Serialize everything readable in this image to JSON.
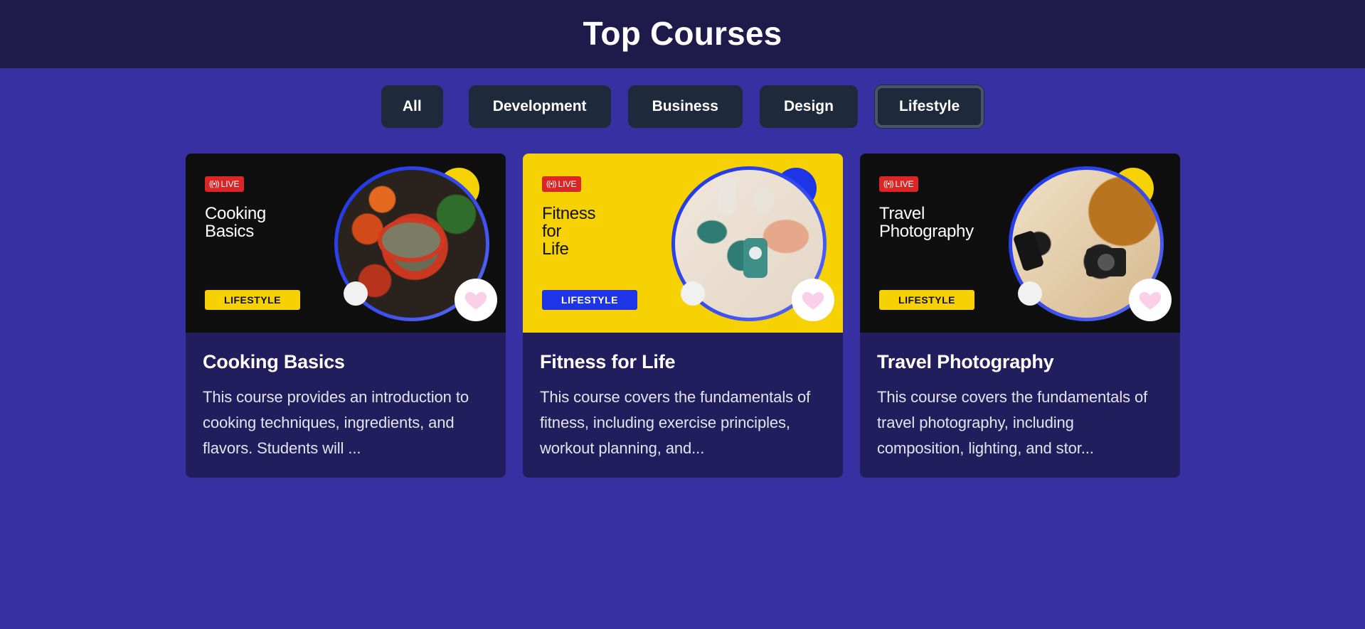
{
  "header": {
    "title": "Top Courses"
  },
  "filters": {
    "all": "All",
    "development": "Development",
    "business": "Business",
    "design": "Design",
    "lifestyle": "Lifestyle",
    "active": "Lifestyle"
  },
  "colors": {
    "page_bg": "#3730a3",
    "header_bg": "#1e1b4b",
    "button_bg": "#1e293b",
    "card_bg": "#221d5c",
    "accent_yellow": "#f6d103",
    "accent_blue": "#1d35e6",
    "live_red": "#dc2626",
    "heart_pink": "#fbcfe8"
  },
  "courses": [
    {
      "live_label": "LIVE",
      "banner_title": "Cooking\nBasics",
      "category_tag": "LIFESTYLE",
      "title": "Cooking Basics",
      "description": "This course provides an introduction to cooking techniques, ingredients, and flavors. Students will ...",
      "photo_icon": "cooking-photo"
    },
    {
      "live_label": "LIVE",
      "banner_title": "Fitness\nfor\nLife",
      "category_tag": "LIFESTYLE",
      "title": "Fitness for Life",
      "description": "This course covers the fundamentals of fitness, including exercise principles, workout planning, and...",
      "photo_icon": "fitness-photo"
    },
    {
      "live_label": "LIVE",
      "banner_title": "Travel\nPhotography",
      "category_tag": "LIFESTYLE",
      "title": "Travel Photography",
      "description": "This course covers the fundamentals of travel photography, including composition, lighting, and stor...",
      "photo_icon": "travel-photo"
    }
  ]
}
